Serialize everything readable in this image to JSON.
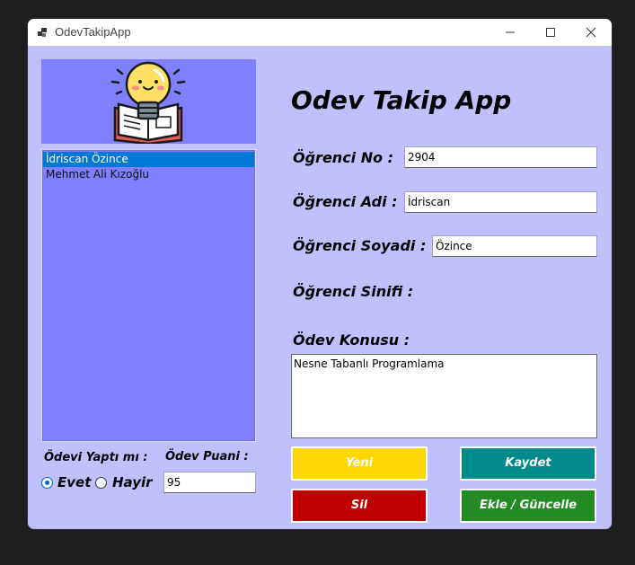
{
  "window": {
    "title": "OdevTakipApp"
  },
  "heading": "Odev Takip App",
  "students": [
    {
      "name": "İdriscan Özince",
      "selected": true
    },
    {
      "name": "Mehmet Ali Kızoğlu",
      "selected": false
    }
  ],
  "form": {
    "no_label": "Öğrenci No :",
    "no_value": "2904",
    "name_label": "Öğrenci Adi :",
    "name_value": "İdriscan",
    "surname_label": "Öğrenci Soyadi :",
    "surname_value": "Özince",
    "class_label": "Öğrenci Sinifi :",
    "topic_label": "Ödev Konusu :",
    "topic_value": "Nesne Tabanlı Programlama",
    "done_label": "Ödevi Yaptı mı :",
    "yes_label": "Evet",
    "no_label_radio": "Hayir",
    "done": true,
    "score_label": "Ödev Puani :",
    "score_value": "95"
  },
  "buttons": {
    "new": {
      "label": "Yeni",
      "color": "#ffd700"
    },
    "save": {
      "label": "Kaydet",
      "color": "#008b8b"
    },
    "delete": {
      "label": "Sil",
      "color": "#c00000"
    },
    "upsert": {
      "label": "Ekle / Güncelle",
      "color": "#228b22"
    }
  },
  "icons": {
    "app": "app-icon",
    "logo": "lightbulb-book-icon",
    "minimize": "minimize-icon",
    "maximize": "maximize-icon",
    "close": "close-icon"
  },
  "colors": {
    "form_background": "#c0c0ff",
    "panel_background": "#8080ff",
    "selection": "#0078d7"
  }
}
